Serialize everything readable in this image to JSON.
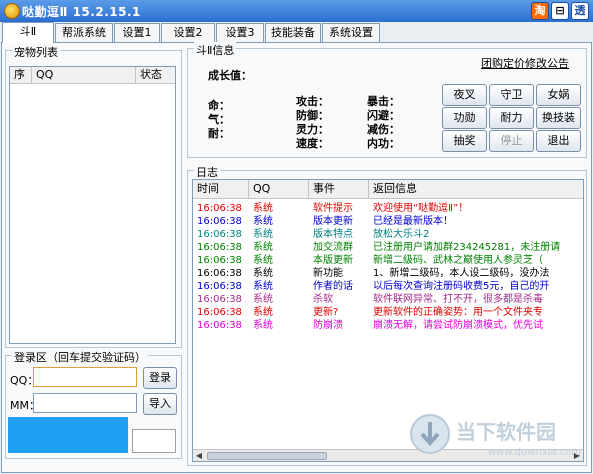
{
  "window": {
    "title": "哒勤逗Ⅱ  15.2.15.1",
    "buttons": {
      "tao": "淘",
      "film": "⊟",
      "transparent": "透"
    }
  },
  "tabs": [
    {
      "label": "斗Ⅱ",
      "active": true
    },
    {
      "label": "帮派系统",
      "active": false
    },
    {
      "label": "设置1",
      "active": false
    },
    {
      "label": "设置2",
      "active": false
    },
    {
      "label": "设置3",
      "active": false
    },
    {
      "label": "技能装备",
      "active": false
    },
    {
      "label": "系统设置",
      "active": false
    }
  ],
  "pet_list": {
    "title": "宠物列表",
    "columns": [
      "序",
      "QQ",
      "状态"
    ]
  },
  "login": {
    "title": "登录区（回车提交验证码）",
    "qq_label": "QQ：",
    "mm_label": "MM：",
    "qq_value": "",
    "mm_value": "",
    "login_button": "登录",
    "import_button": "导入"
  },
  "info": {
    "title": "斗Ⅱ信息",
    "growth_label": "成长值：",
    "buy_link": "团购定价修改公告",
    "stats_col1": [
      "命：",
      "气：",
      "耐："
    ],
    "stats_col2": [
      "攻击：",
      "防御：",
      "灵力：",
      "速度："
    ],
    "stats_col3": [
      "暴击：",
      "闪避：",
      "减伤：",
      "内功："
    ],
    "buttons": [
      {
        "label": "夜叉",
        "enabled": true
      },
      {
        "label": "守卫",
        "enabled": true
      },
      {
        "label": "女娲",
        "enabled": true
      },
      {
        "label": "功勋",
        "enabled": true
      },
      {
        "label": "耐力",
        "enabled": true
      },
      {
        "label": "换技装",
        "enabled": true
      },
      {
        "label": "抽奖",
        "enabled": true
      },
      {
        "label": "停止",
        "enabled": false
      },
      {
        "label": "退出",
        "enabled": true
      }
    ]
  },
  "log": {
    "title": "日志",
    "columns": [
      "时间",
      "QQ",
      "事件",
      "返回信息"
    ],
    "rows": [
      {
        "time": "16:06:38",
        "qq": "系统",
        "event": "软件提示",
        "msg": "欢迎使用“哒勤逗Ⅱ”！",
        "color": "#e00000"
      },
      {
        "time": "16:06:38",
        "qq": "系统",
        "event": "版本更新",
        "msg": "已经是最新版本！",
        "color": "#0000d0"
      },
      {
        "time": "16:06:38",
        "qq": "系统",
        "event": "版本特点",
        "msg": "放松大乐斗2",
        "color": "#008080"
      },
      {
        "time": "16:06:38",
        "qq": "系统",
        "event": "加交流群",
        "msg": "已注册用户请加群234245281，未注册请",
        "color": "#008000"
      },
      {
        "time": "16:06:38",
        "qq": "系统",
        "event": "本版更新",
        "msg": "新增二级码、武林之巅使用人参灵芝（",
        "color": "#008000"
      },
      {
        "time": "16:06:38",
        "qq": "系统",
        "event": "新功能",
        "msg": "1、新增二级码，本人设二级码，没办法",
        "color": "#000000"
      },
      {
        "time": "16:06:38",
        "qq": "系统",
        "event": "作者的话",
        "msg": "以后每次查询注册码收费5元，自己的开",
        "color": "#0000d0"
      },
      {
        "time": "16:06:38",
        "qq": "系统",
        "event": "杀软",
        "msg": "软件联网异常、打不开，很多都是杀毒",
        "color": "#a52a8a"
      },
      {
        "time": "16:06:38",
        "qq": "系统",
        "event": "更新?",
        "msg": "更新软件的正确姿势：用一个文件夹专",
        "color": "#e00000"
      },
      {
        "time": "16:06:38",
        "qq": "系统",
        "event": "防崩溃",
        "msg": "崩溃无解，请尝试防崩溃模式，优先试",
        "color": "#e000e0"
      }
    ]
  },
  "watermark": {
    "title": "当下软件园",
    "url": "www.downxia.com"
  }
}
